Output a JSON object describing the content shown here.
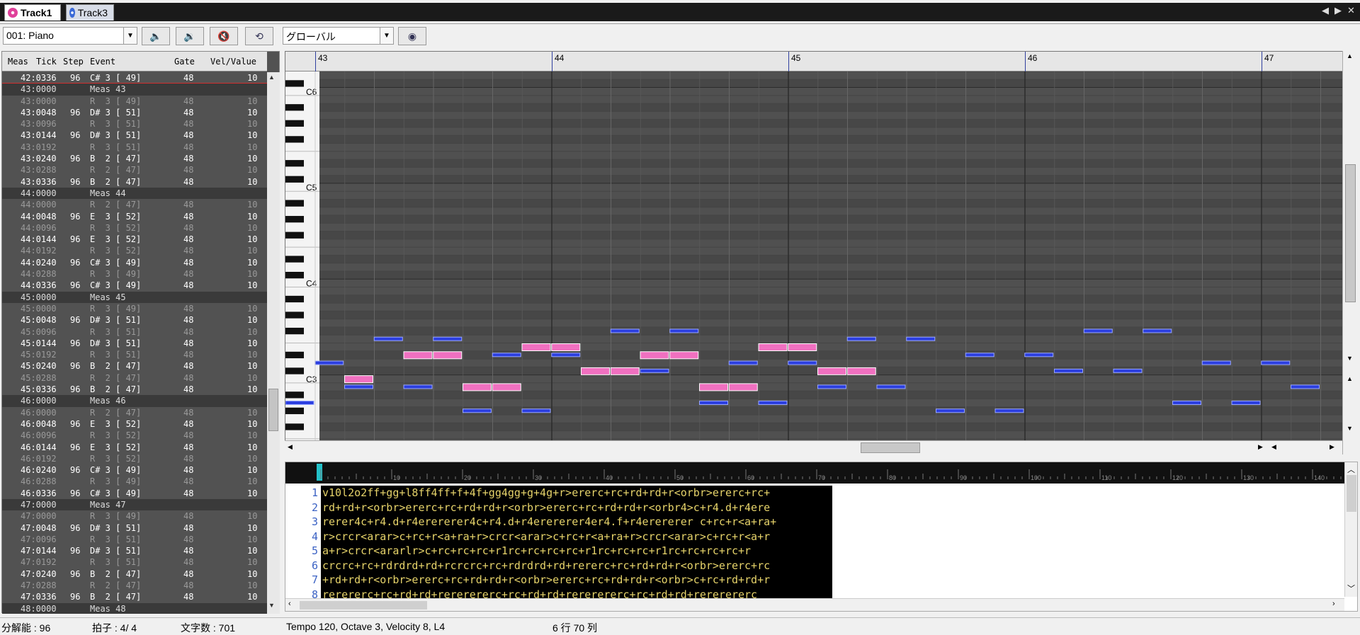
{
  "tabs": [
    {
      "label": "Track1",
      "active": true,
      "color": "#e0409a"
    },
    {
      "label": "Track3",
      "active": false,
      "color": "#3a6ad8"
    }
  ],
  "toolbar": {
    "instrument": "001: Piano",
    "scope": "グローバル"
  },
  "event_list": {
    "headers": [
      "Meas",
      "Tick",
      "Step",
      "Event",
      "Gate",
      "Vel/Value"
    ],
    "rows": [
      {
        "t": "note",
        "pos": "42:0336",
        "step": "96",
        "ev": "C# 3 [ 49]",
        "gate": "48",
        "vel": "10"
      },
      {
        "t": "meas",
        "pos": "43:0000",
        "ev": "Meas 43"
      },
      {
        "t": "rest",
        "pos": "43:0000",
        "step": "",
        "ev": "R  3 [ 49]",
        "gate": "48",
        "vel": "10"
      },
      {
        "t": "note",
        "pos": "43:0048",
        "step": "96",
        "ev": "D# 3 [ 51]",
        "gate": "48",
        "vel": "10"
      },
      {
        "t": "rest",
        "pos": "43:0096",
        "step": "",
        "ev": "R  3 [ 51]",
        "gate": "48",
        "vel": "10"
      },
      {
        "t": "note",
        "pos": "43:0144",
        "step": "96",
        "ev": "D# 3 [ 51]",
        "gate": "48",
        "vel": "10"
      },
      {
        "t": "rest",
        "pos": "43:0192",
        "step": "",
        "ev": "R  3 [ 51]",
        "gate": "48",
        "vel": "10"
      },
      {
        "t": "note",
        "pos": "43:0240",
        "step": "96",
        "ev": "B  2 [ 47]",
        "gate": "48",
        "vel": "10"
      },
      {
        "t": "rest",
        "pos": "43:0288",
        "step": "",
        "ev": "R  2 [ 47]",
        "gate": "48",
        "vel": "10"
      },
      {
        "t": "note",
        "pos": "43:0336",
        "step": "96",
        "ev": "B  2 [ 47]",
        "gate": "48",
        "vel": "10"
      },
      {
        "t": "meas",
        "pos": "44:0000",
        "ev": "Meas 44"
      },
      {
        "t": "rest",
        "pos": "44:0000",
        "step": "",
        "ev": "R  2 [ 47]",
        "gate": "48",
        "vel": "10"
      },
      {
        "t": "note",
        "pos": "44:0048",
        "step": "96",
        "ev": "E  3 [ 52]",
        "gate": "48",
        "vel": "10"
      },
      {
        "t": "rest",
        "pos": "44:0096",
        "step": "",
        "ev": "R  3 [ 52]",
        "gate": "48",
        "vel": "10"
      },
      {
        "t": "note",
        "pos": "44:0144",
        "step": "96",
        "ev": "E  3 [ 52]",
        "gate": "48",
        "vel": "10"
      },
      {
        "t": "rest",
        "pos": "44:0192",
        "step": "",
        "ev": "R  3 [ 52]",
        "gate": "48",
        "vel": "10"
      },
      {
        "t": "note",
        "pos": "44:0240",
        "step": "96",
        "ev": "C# 3 [ 49]",
        "gate": "48",
        "vel": "10"
      },
      {
        "t": "rest",
        "pos": "44:0288",
        "step": "",
        "ev": "R  3 [ 49]",
        "gate": "48",
        "vel": "10"
      },
      {
        "t": "note",
        "pos": "44:0336",
        "step": "96",
        "ev": "C# 3 [ 49]",
        "gate": "48",
        "vel": "10"
      },
      {
        "t": "meas",
        "pos": "45:0000",
        "ev": "Meas 45"
      },
      {
        "t": "rest",
        "pos": "45:0000",
        "step": "",
        "ev": "R  3 [ 49]",
        "gate": "48",
        "vel": "10"
      },
      {
        "t": "note",
        "pos": "45:0048",
        "step": "96",
        "ev": "D# 3 [ 51]",
        "gate": "48",
        "vel": "10"
      },
      {
        "t": "rest",
        "pos": "45:0096",
        "step": "",
        "ev": "R  3 [ 51]",
        "gate": "48",
        "vel": "10"
      },
      {
        "t": "note",
        "pos": "45:0144",
        "step": "96",
        "ev": "D# 3 [ 51]",
        "gate": "48",
        "vel": "10"
      },
      {
        "t": "rest",
        "pos": "45:0192",
        "step": "",
        "ev": "R  3 [ 51]",
        "gate": "48",
        "vel": "10"
      },
      {
        "t": "note",
        "pos": "45:0240",
        "step": "96",
        "ev": "B  2 [ 47]",
        "gate": "48",
        "vel": "10"
      },
      {
        "t": "rest",
        "pos": "45:0288",
        "step": "",
        "ev": "R  2 [ 47]",
        "gate": "48",
        "vel": "10"
      },
      {
        "t": "note",
        "pos": "45:0336",
        "step": "96",
        "ev": "B  2 [ 47]",
        "gate": "48",
        "vel": "10"
      },
      {
        "t": "meas",
        "pos": "46:0000",
        "ev": "Meas 46"
      },
      {
        "t": "rest",
        "pos": "46:0000",
        "step": "",
        "ev": "R  2 [ 47]",
        "gate": "48",
        "vel": "10"
      },
      {
        "t": "note",
        "pos": "46:0048",
        "step": "96",
        "ev": "E  3 [ 52]",
        "gate": "48",
        "vel": "10"
      },
      {
        "t": "rest",
        "pos": "46:0096",
        "step": "",
        "ev": "R  3 [ 52]",
        "gate": "48",
        "vel": "10"
      },
      {
        "t": "note",
        "pos": "46:0144",
        "step": "96",
        "ev": "E  3 [ 52]",
        "gate": "48",
        "vel": "10"
      },
      {
        "t": "rest",
        "pos": "46:0192",
        "step": "",
        "ev": "R  3 [ 52]",
        "gate": "48",
        "vel": "10"
      },
      {
        "t": "note",
        "pos": "46:0240",
        "step": "96",
        "ev": "C# 3 [ 49]",
        "gate": "48",
        "vel": "10"
      },
      {
        "t": "rest",
        "pos": "46:0288",
        "step": "",
        "ev": "R  3 [ 49]",
        "gate": "48",
        "vel": "10"
      },
      {
        "t": "note",
        "pos": "46:0336",
        "step": "96",
        "ev": "C# 3 [ 49]",
        "gate": "48",
        "vel": "10"
      },
      {
        "t": "meas",
        "pos": "47:0000",
        "ev": "Meas 47"
      },
      {
        "t": "rest",
        "pos": "47:0000",
        "step": "",
        "ev": "R  3 [ 49]",
        "gate": "48",
        "vel": "10"
      },
      {
        "t": "note",
        "pos": "47:0048",
        "step": "96",
        "ev": "D# 3 [ 51]",
        "gate": "48",
        "vel": "10"
      },
      {
        "t": "rest",
        "pos": "47:0096",
        "step": "",
        "ev": "R  3 [ 51]",
        "gate": "48",
        "vel": "10"
      },
      {
        "t": "note",
        "pos": "47:0144",
        "step": "96",
        "ev": "D# 3 [ 51]",
        "gate": "48",
        "vel": "10"
      },
      {
        "t": "rest",
        "pos": "47:0192",
        "step": "",
        "ev": "R  3 [ 51]",
        "gate": "48",
        "vel": "10"
      },
      {
        "t": "note",
        "pos": "47:0240",
        "step": "96",
        "ev": "B  2 [ 47]",
        "gate": "48",
        "vel": "10"
      },
      {
        "t": "rest",
        "pos": "47:0288",
        "step": "",
        "ev": "R  2 [ 47]",
        "gate": "48",
        "vel": "10"
      },
      {
        "t": "note",
        "pos": "47:0336",
        "step": "96",
        "ev": "B  2 [ 47]",
        "gate": "48",
        "vel": "10"
      },
      {
        "t": "meas",
        "pos": "48:0000",
        "ev": "Meas 48"
      }
    ]
  },
  "piano_roll": {
    "measures": [
      "43",
      "44",
      "45",
      "46",
      "47"
    ],
    "octave_labels": [
      "C6",
      "C5",
      "C4",
      "C3"
    ],
    "pink": "#f070c0",
    "blue": "#2b3ee0",
    "highlight_notes": [
      {
        "beat": 1.0,
        "pitch": "C3"
      },
      {
        "beat": 2.0,
        "pitch": "D#3"
      },
      {
        "beat": 2.5,
        "pitch": "D#3"
      },
      {
        "beat": 3.0,
        "pitch": "B2"
      },
      {
        "beat": 3.5,
        "pitch": "B2"
      },
      {
        "beat": 4.0,
        "pitch": "E3"
      },
      {
        "beat": 4.5,
        "pitch": "E3"
      },
      {
        "beat": 5.0,
        "pitch": "C#3"
      },
      {
        "beat": 5.5,
        "pitch": "C#3"
      },
      {
        "beat": 6.0,
        "pitch": "D#3"
      },
      {
        "beat": 6.5,
        "pitch": "D#3"
      },
      {
        "beat": 7.0,
        "pitch": "B2"
      },
      {
        "beat": 7.5,
        "pitch": "B2"
      },
      {
        "beat": 8.0,
        "pitch": "E3"
      },
      {
        "beat": 8.5,
        "pitch": "E3"
      },
      {
        "beat": 9.0,
        "pitch": "C#3"
      },
      {
        "beat": 9.5,
        "pitch": "C#3"
      }
    ],
    "other_notes": [
      {
        "beat": 0.0,
        "pitch": "A2"
      },
      {
        "beat": 0.5,
        "pitch": "D3"
      },
      {
        "beat": 1.0,
        "pitch": "B2"
      },
      {
        "beat": 1.5,
        "pitch": "F3"
      },
      {
        "beat": 2.0,
        "pitch": "B2"
      },
      {
        "beat": 2.5,
        "pitch": "F3"
      },
      {
        "beat": 3.0,
        "pitch": "G#2"
      },
      {
        "beat": 3.5,
        "pitch": "D#3"
      },
      {
        "beat": 4.0,
        "pitch": "G#2"
      },
      {
        "beat": 4.5,
        "pitch": "D#3"
      },
      {
        "beat": 5.0,
        "pitch": "C#3"
      },
      {
        "beat": 5.5,
        "pitch": "F#3"
      },
      {
        "beat": 6.0,
        "pitch": "C#3"
      },
      {
        "beat": 6.5,
        "pitch": "F#3"
      },
      {
        "beat": 7.0,
        "pitch": "A2"
      },
      {
        "beat": 7.5,
        "pitch": "D3"
      },
      {
        "beat": 8.0,
        "pitch": "A2"
      },
      {
        "beat": 8.5,
        "pitch": "D3"
      },
      {
        "beat": 9.0,
        "pitch": "B2"
      },
      {
        "beat": 9.5,
        "pitch": "F3"
      },
      {
        "beat": 10.0,
        "pitch": "B2"
      },
      {
        "beat": 10.5,
        "pitch": "F3"
      },
      {
        "beat": 11.0,
        "pitch": "G#2"
      },
      {
        "beat": 11.5,
        "pitch": "D#3"
      },
      {
        "beat": 12.0,
        "pitch": "G#2"
      },
      {
        "beat": 12.5,
        "pitch": "D#3"
      },
      {
        "beat": 13.0,
        "pitch": "C#3"
      },
      {
        "beat": 13.5,
        "pitch": "F#3"
      },
      {
        "beat": 14.0,
        "pitch": "C#3"
      },
      {
        "beat": 14.5,
        "pitch": "F#3"
      },
      {
        "beat": 15.0,
        "pitch": "A2"
      },
      {
        "beat": 15.5,
        "pitch": "D3"
      },
      {
        "beat": 16.0,
        "pitch": "A2"
      },
      {
        "beat": 16.5,
        "pitch": "D3"
      },
      {
        "beat": 17.0,
        "pitch": "B2"
      }
    ]
  },
  "mml": {
    "lines": [
      "v10l2o2ff+gg+l8ff4ff+f+4f+gg4gg+g+4g+r>ererc+rc+rd+rd+r<orbr>ererc+rc+",
      "rd+rd+r<orbr>ererc+rc+rd+rd+r<orbr>ererc+rc+rd+rd+r<orbr4>c+r4.d+r4ere",
      "rerer4c+r4.d+r4erererer4c+r4.d+r4erererer4er4.f+r4erererer c+rc+r<a+ra+",
      "r>crcr<arar>c+rc+r<a+ra+r>crcr<arar>c+rc+r<a+ra+r>crcr<arar>c+rc+r<a+r",
      "a+r>crcr<ararlr>c+rc+rc+rc+r1rc+rc+rc+rc+r1rc+rc+rc+r1rc+rc+rc+rc+r",
      "crcrc+rc+rdrdrd+rd+rcrcrc+rc+rdrdrd+rd+rererc+rc+rd+rd+r<orbr>ererc+rc",
      "+rd+rd+r<orbr>ererc+rc+rd+rd+r<orbr>ererc+rc+rd+rd+r<orbr>c+rc+rd+rd+r",
      "rerererc+rc+rd+rd+rererererc+rc+rd+rd+rererererc+rc+rd+rd+rererererc"
    ]
  },
  "status": {
    "resolution": "分解能 : 96",
    "time_sig": "拍子 : 4/ 4",
    "char_count": "文字数 : 701",
    "info": "Tempo 120, Octave 3, Velocity 8, L4",
    "cursor": "6 行 70 列"
  }
}
